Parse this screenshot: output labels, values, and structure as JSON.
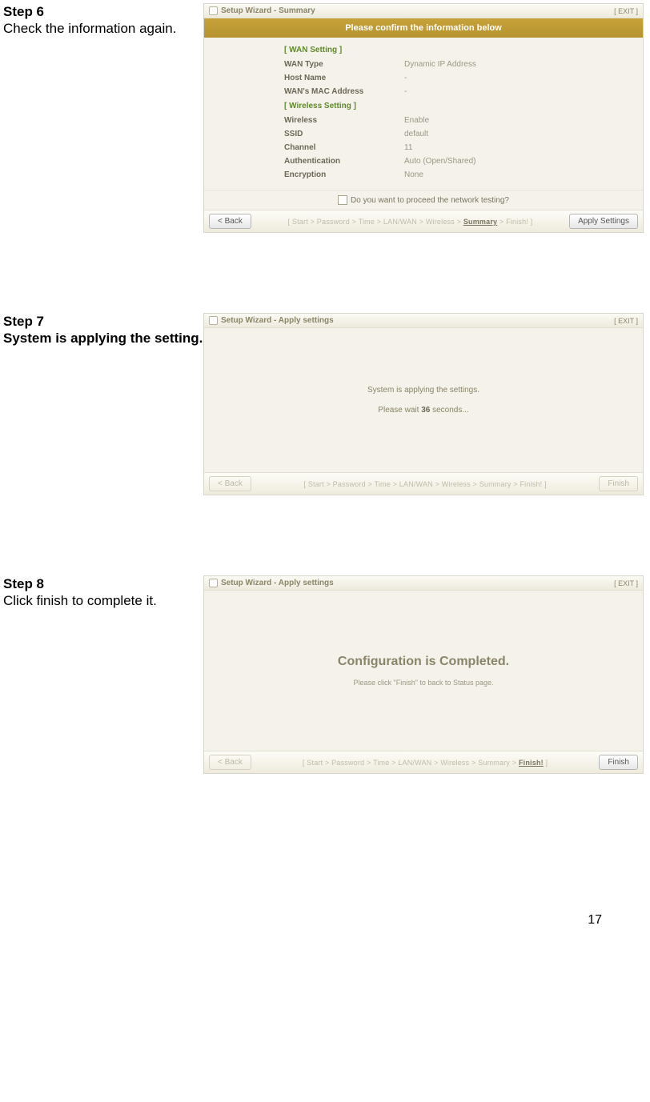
{
  "page_number": "17",
  "step6": {
    "title": "Step 6",
    "desc": "Check the information again.",
    "window_title": "Setup Wizard - Summary",
    "exit": "[ EXIT ]",
    "banner": "Please confirm the information below",
    "section_wan": "[ WAN Setting ]",
    "wan_type_k": "WAN Type",
    "wan_type_v": "Dynamic IP Address",
    "host_name_k": "Host Name",
    "host_name_v": "-",
    "mac_k": "WAN's MAC Address",
    "mac_v": "-",
    "section_wl": "[ Wireless Setting ]",
    "wireless_k": "Wireless",
    "wireless_v": "Enable",
    "ssid_k": "SSID",
    "ssid_v": "default",
    "channel_k": "Channel",
    "channel_v": "11",
    "auth_k": "Authentication",
    "auth_v": "Auto (Open/Shared)",
    "enc_k": "Encryption",
    "enc_v": "None",
    "proceed": "Do you want to proceed the network testing?",
    "back": "< Back",
    "crumbs_pre": "[ Start > Password > Time > LAN/WAN > Wireless > ",
    "crumbs_hl": "Summary",
    "crumbs_post": " > Finish! ]",
    "apply": "Apply Settings"
  },
  "step7": {
    "title": "Step 7",
    "desc": "System is applying the setting.",
    "window_title": "Setup Wizard - Apply settings",
    "exit": "[ EXIT ]",
    "line1": "System is applying the settings.",
    "line2a": "Please wait ",
    "line2b": "36",
    "line2c": " seconds...",
    "back": "< Back",
    "crumbs": "[ Start > Password > Time > LAN/WAN > Wireless > Summary > Finish! ]",
    "finish": "Finish"
  },
  "step8": {
    "title": "Step 8",
    "desc": "Click finish to complete it.",
    "window_title": "Setup Wizard - Apply settings",
    "exit": "[ EXIT ]",
    "big": "Configuration is Completed.",
    "small": "Please click \"Finish\" to back to Status page.",
    "back": "< Back",
    "crumbs_pre": "[ Start > Password > Time > LAN/WAN > Wireless > Summary > ",
    "crumbs_hl": "Finish!",
    "crumbs_post": " ]",
    "finish": "Finish"
  }
}
